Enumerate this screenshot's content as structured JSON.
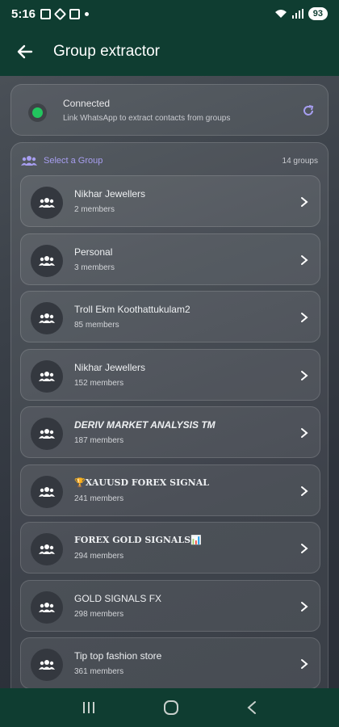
{
  "status_bar": {
    "time": "5:16",
    "battery": "93"
  },
  "app_bar": {
    "title": "Group extractor"
  },
  "connection": {
    "title": "Connected",
    "subtitle": "Link WhatsApp to extract contacts from groups",
    "status_color": "#22c55e"
  },
  "groups_panel": {
    "label": "Select a Group",
    "count": "14 groups",
    "items": [
      {
        "name": "Nikhar Jewellers",
        "members": "2 members"
      },
      {
        "name": "Personal",
        "members": "3 members"
      },
      {
        "name": "Troll Ekm Koothattukulam2",
        "members": "85 members"
      },
      {
        "name": "Nikhar Jewellers",
        "members": "152 members"
      },
      {
        "name": "DERIV MARKET ANALYSIS TM",
        "members": "187 members"
      },
      {
        "name": "🏆XAUUSD FOREX SIGNAL",
        "members": "241 members"
      },
      {
        "name": "FOREX GOLD SIGNALS📊",
        "members": "294 members"
      },
      {
        "name": "GOLD SIGNALS FX",
        "members": "298 members"
      },
      {
        "name": "Tip top fashion store",
        "members": "361 members"
      }
    ]
  },
  "colors": {
    "primary": "#0f3d31",
    "accent": "#a79ef0"
  }
}
